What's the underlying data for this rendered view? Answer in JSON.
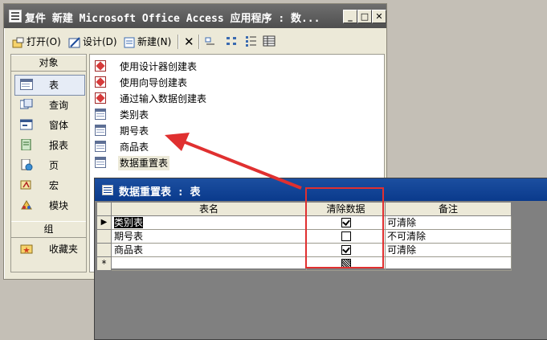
{
  "window": {
    "title": "复件 新建 Microsoft Office Access 应用程序 : 数...",
    "min": "_",
    "max": "□",
    "close": "✕"
  },
  "toolbar": {
    "open": "打开(O)",
    "design": "设计(D)",
    "new": "新建(N)",
    "delete": "✕"
  },
  "sidebar": {
    "objects_header": "对象",
    "items": [
      {
        "label": "表"
      },
      {
        "label": "查询"
      },
      {
        "label": "窗体"
      },
      {
        "label": "报表"
      },
      {
        "label": "页"
      },
      {
        "label": "宏"
      },
      {
        "label": "模块"
      }
    ],
    "groups_header": "组",
    "favorites": "收藏夹"
  },
  "list": {
    "items": [
      {
        "label": "使用设计器创建表"
      },
      {
        "label": "使用向导创建表"
      },
      {
        "label": "通过输入数据创建表"
      },
      {
        "label": "类别表"
      },
      {
        "label": "期号表"
      },
      {
        "label": "商品表"
      },
      {
        "label": "数据重置表"
      }
    ]
  },
  "subwindow": {
    "title": "数据重置表 : 表",
    "columns": [
      "表名",
      "清除数据",
      "备注"
    ],
    "rows": [
      {
        "selector": "▶",
        "name": "类别表",
        "clear": true,
        "note": "可清除"
      },
      {
        "selector": "",
        "name": "期号表",
        "clear": false,
        "note": "不可清除"
      },
      {
        "selector": "",
        "name": "商品表",
        "clear": true,
        "note": "可清除"
      },
      {
        "selector": "*",
        "name": "",
        "clear": null,
        "note": ""
      }
    ]
  },
  "colors": {
    "annotation": "#e03030",
    "subtitle_bar": "#0a3a8c"
  }
}
